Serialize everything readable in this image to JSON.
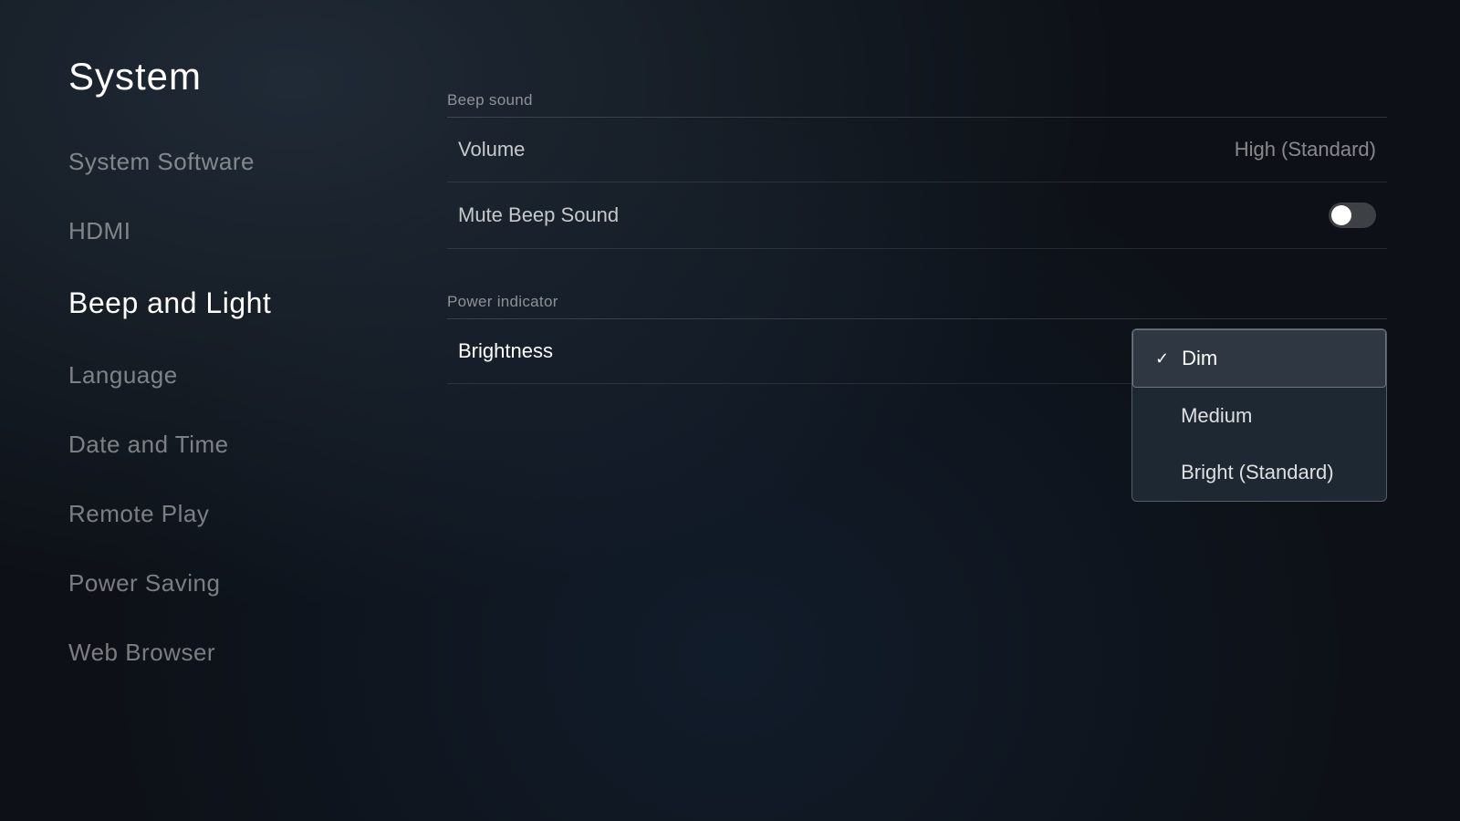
{
  "page": {
    "title": "System"
  },
  "sidebar": {
    "items": [
      {
        "id": "system-software",
        "label": "System Software",
        "active": false
      },
      {
        "id": "hdmi",
        "label": "HDMI",
        "active": false
      },
      {
        "id": "beep-and-light",
        "label": "Beep and Light",
        "active": true
      },
      {
        "id": "language",
        "label": "Language",
        "active": false
      },
      {
        "id": "date-and-time",
        "label": "Date and Time",
        "active": false
      },
      {
        "id": "remote-play",
        "label": "Remote Play",
        "active": false
      },
      {
        "id": "power-saving",
        "label": "Power Saving",
        "active": false
      },
      {
        "id": "web-browser",
        "label": "Web Browser",
        "active": false
      }
    ]
  },
  "main": {
    "beep_sound_section_label": "Beep sound",
    "volume_label": "Volume",
    "volume_value": "High (Standard)",
    "mute_beep_label": "Mute Beep Sound",
    "power_indicator_section_label": "Power indicator",
    "brightness_label": "Brightness",
    "dropdown": {
      "options": [
        {
          "id": "dim",
          "label": "Dim",
          "selected": true
        },
        {
          "id": "medium",
          "label": "Medium",
          "selected": false
        },
        {
          "id": "bright",
          "label": "Bright (Standard)",
          "selected": false
        }
      ]
    }
  }
}
